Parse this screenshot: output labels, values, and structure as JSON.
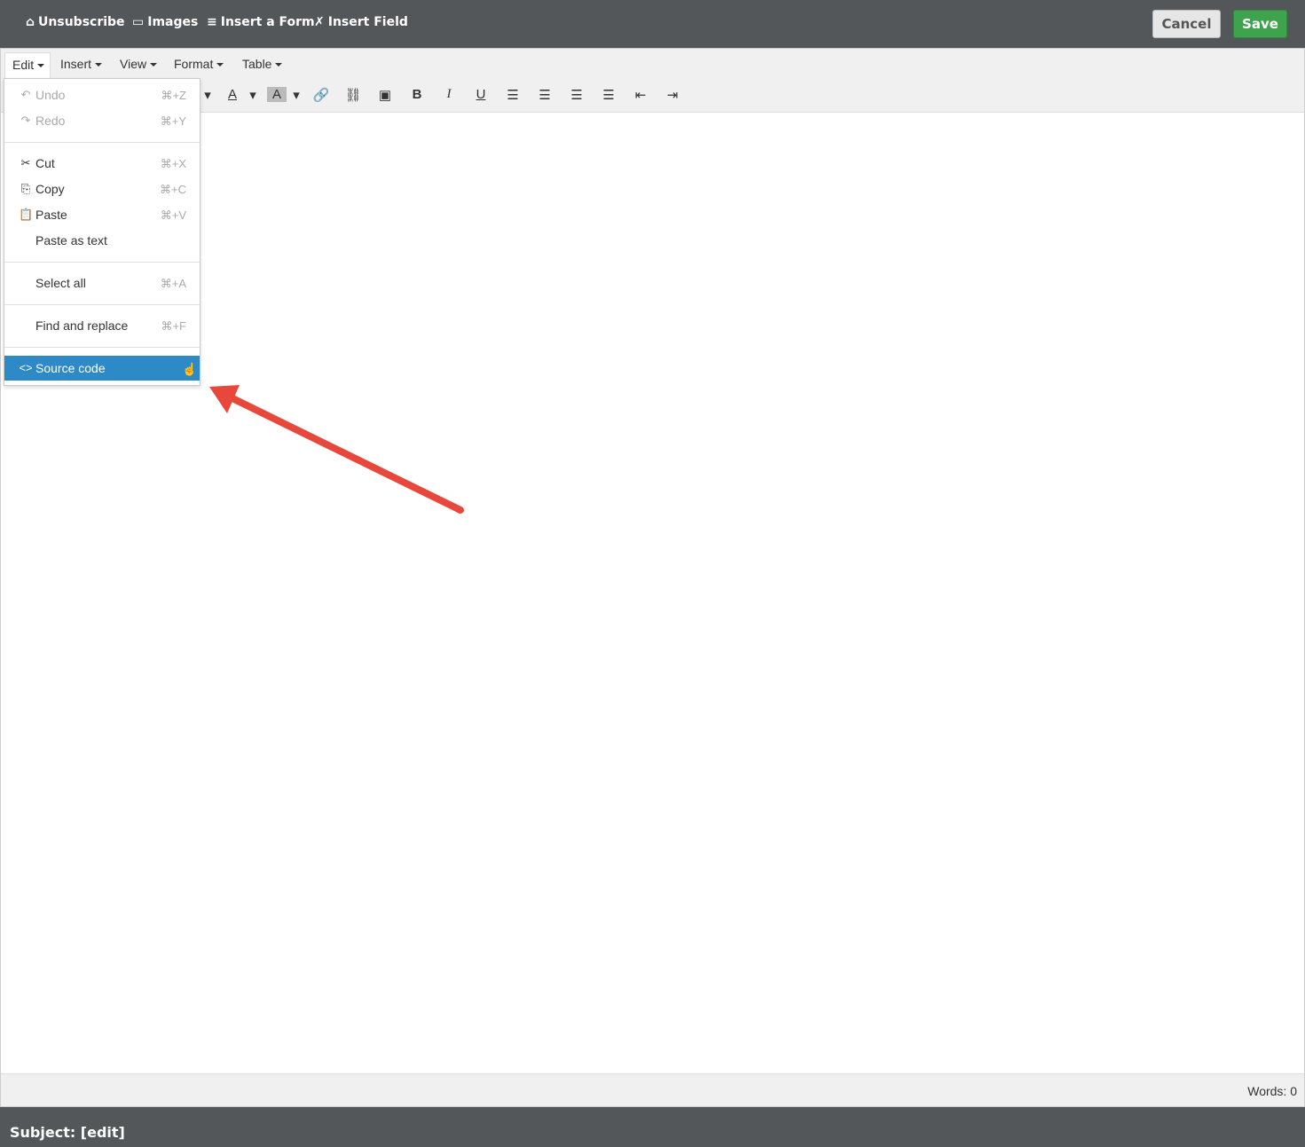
{
  "topbar": {
    "items": [
      {
        "icon": "door-icon",
        "label": "Unsubscribe"
      },
      {
        "icon": "images-icon",
        "label": "Images"
      },
      {
        "icon": "list-icon",
        "label": "Insert a Form"
      },
      {
        "icon": "tools-icon",
        "label": "Insert Field"
      }
    ],
    "cancel": "Cancel",
    "save": "Save"
  },
  "menubar": [
    "Edit",
    "Insert",
    "View",
    "Format",
    "Table"
  ],
  "edit_menu": [
    {
      "icon": "↶",
      "label": "Undo",
      "shortcut": "⌘+Z",
      "disabled": true
    },
    {
      "icon": "↷",
      "label": "Redo",
      "shortcut": "⌘+Y",
      "disabled": true
    },
    {
      "icon": "✂",
      "label": "Cut",
      "shortcut": "⌘+X"
    },
    {
      "icon": "⎘",
      "label": "Copy",
      "shortcut": "⌘+C"
    },
    {
      "icon": "📋",
      "label": "Paste",
      "shortcut": "⌘+V"
    },
    {
      "icon": "",
      "label": "Paste as text",
      "shortcut": ""
    },
    {
      "icon": "",
      "label": "Select all",
      "shortcut": "⌘+A"
    },
    {
      "icon": "",
      "label": "Find and replace",
      "shortcut": "⌘+F"
    },
    {
      "icon": "<>",
      "label": "Source code",
      "shortcut": "",
      "highlighted": true
    }
  ],
  "status": {
    "words": "Words: 0"
  },
  "subject": "Subject:  [edit]",
  "colors": {
    "accent": "#2d8ac7",
    "save": "#3fa34d",
    "topbar": "#53575a",
    "arrow": "#e8483b"
  }
}
